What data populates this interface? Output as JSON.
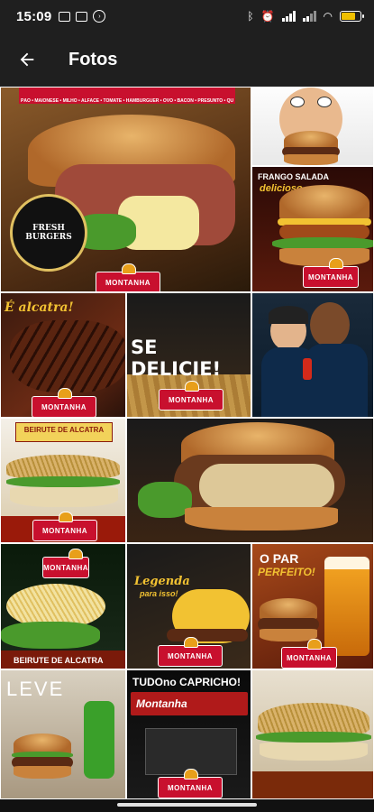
{
  "status": {
    "time": "15:09"
  },
  "header": {
    "title": "Fotos",
    "back_icon": "arrow-left-icon"
  },
  "photos": [
    {
      "id": "p1",
      "caption": "FRESH BURGERS",
      "subcaption": "MONTANHA",
      "topbar": "PÃO • MAIONESE • MILHO • ALFACE • TOMATE • HAMBURGUER • OVO • BACON • PRESUNTO • QUEIJO"
    },
    {
      "id": "p2",
      "caption": ""
    },
    {
      "id": "p3",
      "caption": "FRANGO SALADA",
      "subcaption": "delicioso",
      "brand": "MONTANHA"
    },
    {
      "id": "p4",
      "caption": "É alcatra!",
      "brand": "MONTANHA"
    },
    {
      "id": "p5",
      "caption": "SE DELICIE!",
      "brand": "MONTANHA"
    },
    {
      "id": "p6",
      "caption": ""
    },
    {
      "id": "p7",
      "caption": "BEIRUTE DE ALCATRA",
      "brand": "MONTANHA"
    },
    {
      "id": "p8",
      "caption": ""
    },
    {
      "id": "p9",
      "caption": "BEIRUTE DE ALCATRA",
      "brand": "MONTANHA"
    },
    {
      "id": "p10",
      "caption": "Legenda",
      "subcaption": "para isso!",
      "brand": "MONTANHA"
    },
    {
      "id": "p11",
      "caption": "O PAR",
      "subcaption": "PERFEITO!",
      "brand": "MONTANHA"
    },
    {
      "id": "p12",
      "caption": "LEVE"
    },
    {
      "id": "p13",
      "caption": "TUDO",
      "subcaption": "no CAPRICHO!",
      "brand": "MONTANHA",
      "sign": "Montanha"
    },
    {
      "id": "p14",
      "caption": ""
    }
  ]
}
